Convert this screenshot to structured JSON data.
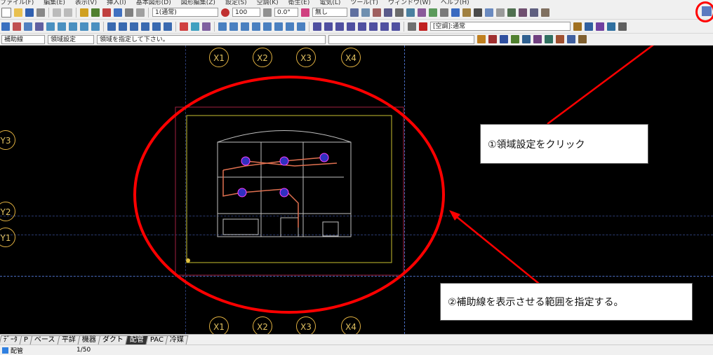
{
  "menu": [
    "ファイル(F)",
    "編集(E)",
    "表示(V)",
    "挿入(I)",
    "基本図形(D)",
    "図形編集(Z)",
    "設定(S)",
    "空調(K)",
    "衛生(E)",
    "電気(L)",
    "ツール(T)",
    "ウィンドウ(W)",
    "ヘルプ(H)"
  ],
  "toolbar1": {
    "line_scale": "1(通常)",
    "opacity": "100",
    "angle": "0.0°",
    "fill": "無し"
  },
  "toolbar2": {
    "layer_combo": "[空調]:通常"
  },
  "toolbar3": {
    "mode": "補助線",
    "command": "領域設定",
    "prompt": "領域を指定して下さい。"
  },
  "grid": {
    "top": [
      "X1",
      "X2",
      "X3",
      "X4"
    ],
    "bottom": [
      "X1",
      "X2",
      "X3",
      "X4"
    ],
    "left": [
      "Y3",
      "Y2",
      "Y1"
    ]
  },
  "callouts": {
    "step1": "①領域設定をクリック",
    "step2": "②補助線を表示させる範囲を指定する。"
  },
  "tabs": [
    "ﾃﾞｰﾀ",
    "P",
    "ベース",
    "平詳",
    "機器",
    "ダクト",
    "配管",
    "PAC",
    "冷媒"
  ],
  "active_tab": "配管",
  "status": {
    "layer": "配管",
    "scale": "1/50"
  },
  "colors": {
    "annotation": "#ff0000",
    "grid": "#e0b040",
    "aux_line": "#4a6cc0"
  }
}
